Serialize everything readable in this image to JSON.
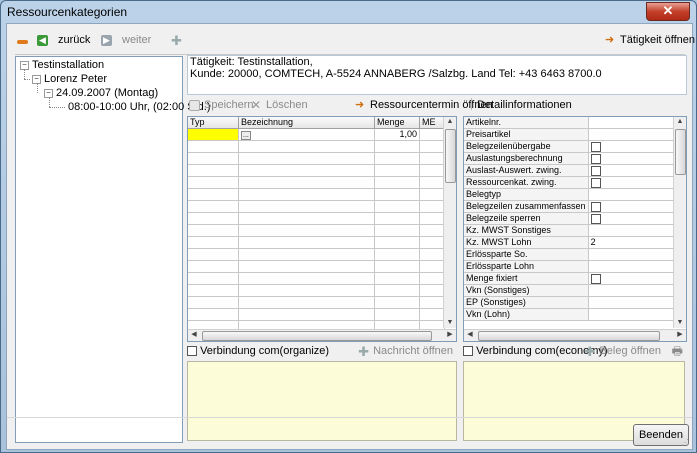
{
  "window": {
    "title": "Ressourcenkategorien",
    "close_symbol": "✕"
  },
  "toolbar": {
    "back_label": "zurück",
    "forward_label": "weiter",
    "open_activity_label": "Tätigkeit öffnen"
  },
  "tree": {
    "root": "Testinstallation",
    "person": "Lorenz Peter",
    "date": "24.09.2007 (Montag)",
    "slot": "08:00-10:00 Uhr, (02:00 Std.)"
  },
  "activity_info": {
    "line1": "Tätigkeit: Testinstallation,",
    "line2": "Kunde: 20000, COMTECH, A-5524 ANNABERG /Salzbg. Land Tel: +43 6463 8700.0"
  },
  "actions": {
    "save_label": "Speichern",
    "delete_label": "Löschen",
    "open_resource_appointment_label": "Ressourcentermin öffnen",
    "detail_info_label": "Detailinformationen"
  },
  "items_grid": {
    "columns": [
      "Typ",
      "Bezeichnung",
      "Menge",
      "ME"
    ],
    "rows": [
      {
        "typ": "",
        "bezeichnung": "...",
        "menge": "1,00",
        "me": ""
      }
    ]
  },
  "details": {
    "rows": [
      {
        "label": "Artikelnr.",
        "value": "",
        "checkbox": false
      },
      {
        "label": "Preisartikel",
        "value": "",
        "checkbox": false
      },
      {
        "label": "Belegzeilenübergabe",
        "value": "",
        "checkbox": true
      },
      {
        "label": "Auslastungsberechnung",
        "value": "",
        "checkbox": true
      },
      {
        "label": "Auslast-Auswert. zwing.",
        "value": "",
        "checkbox": true
      },
      {
        "label": "Ressourcenkat. zwing.",
        "value": "",
        "checkbox": true
      },
      {
        "label": "Belegtyp",
        "value": "",
        "checkbox": false
      },
      {
        "label": "Belegzeilen zusammenfassen",
        "value": "",
        "checkbox": true
      },
      {
        "label": "Belegzeile sperren",
        "value": "",
        "checkbox": true
      },
      {
        "label": "Kz. MWST Sonstiges",
        "value": "",
        "checkbox": false
      },
      {
        "label": "Kz. MWST Lohn",
        "value": "2",
        "checkbox": false
      },
      {
        "label": "Erlössparte So.",
        "value": "",
        "checkbox": false
      },
      {
        "label": "Erlössparte Lohn",
        "value": "",
        "checkbox": false
      },
      {
        "label": "Menge fixiert",
        "value": "",
        "checkbox": true
      },
      {
        "label": "Vkn (Sonstiges)",
        "value": "",
        "checkbox": false
      },
      {
        "label": "EP (Sonstiges)",
        "value": "",
        "checkbox": false
      },
      {
        "label": "Vkn (Lohn)",
        "value": "",
        "checkbox": false
      }
    ]
  },
  "organize_panel": {
    "checkbox_label": "Verbindung com(organize)",
    "open_message_label": "Nachricht öffnen"
  },
  "economy_panel": {
    "checkbox_label": "Verbindung com(economy)",
    "open_document_label": "Beleg öffnen"
  },
  "footer": {
    "close_button_label": "Beenden"
  }
}
